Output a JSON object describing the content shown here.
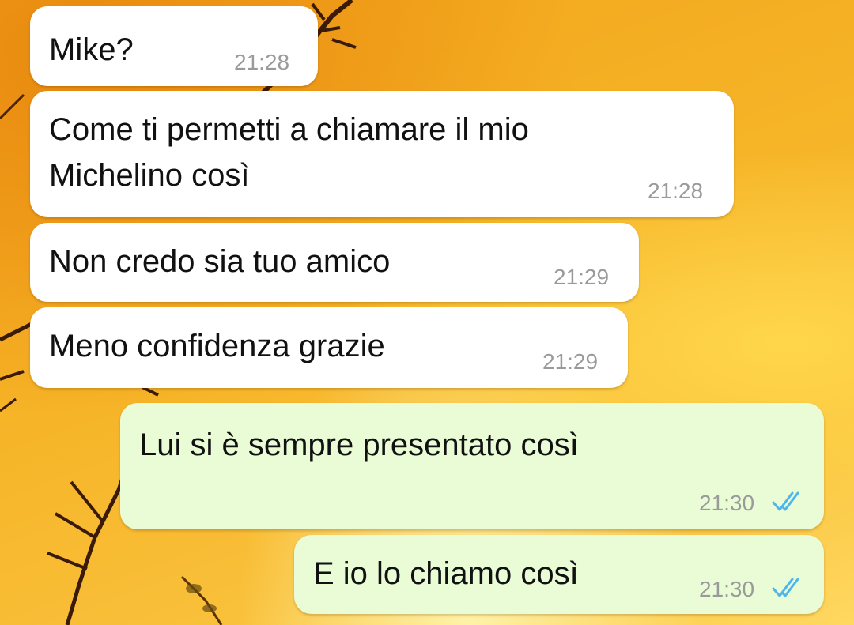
{
  "messages": [
    {
      "direction": "incoming",
      "lines": [
        "Mike?"
      ],
      "time": "21:28"
    },
    {
      "direction": "incoming",
      "lines": [
        "Come ti permetti a chiamare il mio",
        "Michelino così"
      ],
      "time": "21:28"
    },
    {
      "direction": "incoming",
      "lines": [
        "Non credo sia tuo amico"
      ],
      "time": "21:29"
    },
    {
      "direction": "incoming",
      "lines": [
        "Meno confidenza grazie"
      ],
      "time": "21:29"
    },
    {
      "direction": "outgoing",
      "lines": [
        "Lui si è sempre presentato così"
      ],
      "time": "21:30",
      "status": "read"
    },
    {
      "direction": "outgoing",
      "lines": [
        "E io lo chiamo così"
      ],
      "time": "21:30",
      "status": "read"
    }
  ],
  "colors": {
    "incoming_bubble": "#ffffff",
    "outgoing_bubble": "#e9fcd6",
    "read_ticks": "#4fb6ec",
    "time_text": "#9a9a9a",
    "wallpaper": "#f6b427"
  },
  "icons": {
    "read_receipt": "double-check-icon"
  }
}
